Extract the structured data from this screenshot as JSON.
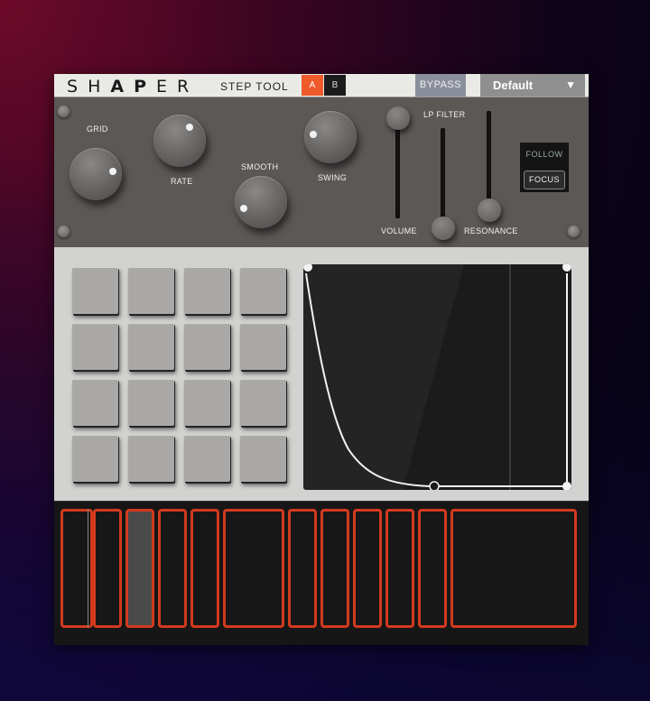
{
  "header": {
    "logo": "SHAPER",
    "subtitle": "STEP TOOL",
    "bank_a": "A",
    "bank_b": "B",
    "bypass": "BYPASS",
    "preset": "Default",
    "preset_arrow": "▼"
  },
  "controls": {
    "grid": "GRID",
    "rate": "RATE",
    "smooth": "SMOOTH",
    "swing": "SWING",
    "lp_filter": "LP FILTER",
    "volume": "VOLUME",
    "resonance": "RESONANCE",
    "follow": "FOLLOW",
    "focus": "FOCUS"
  },
  "colors": {
    "accent": "#d23a1e",
    "bank_a_active": "#ee5a2a"
  },
  "pads": {
    "rows": 4,
    "cols": 4
  },
  "steps": {
    "count": 12,
    "active_index": 2
  }
}
